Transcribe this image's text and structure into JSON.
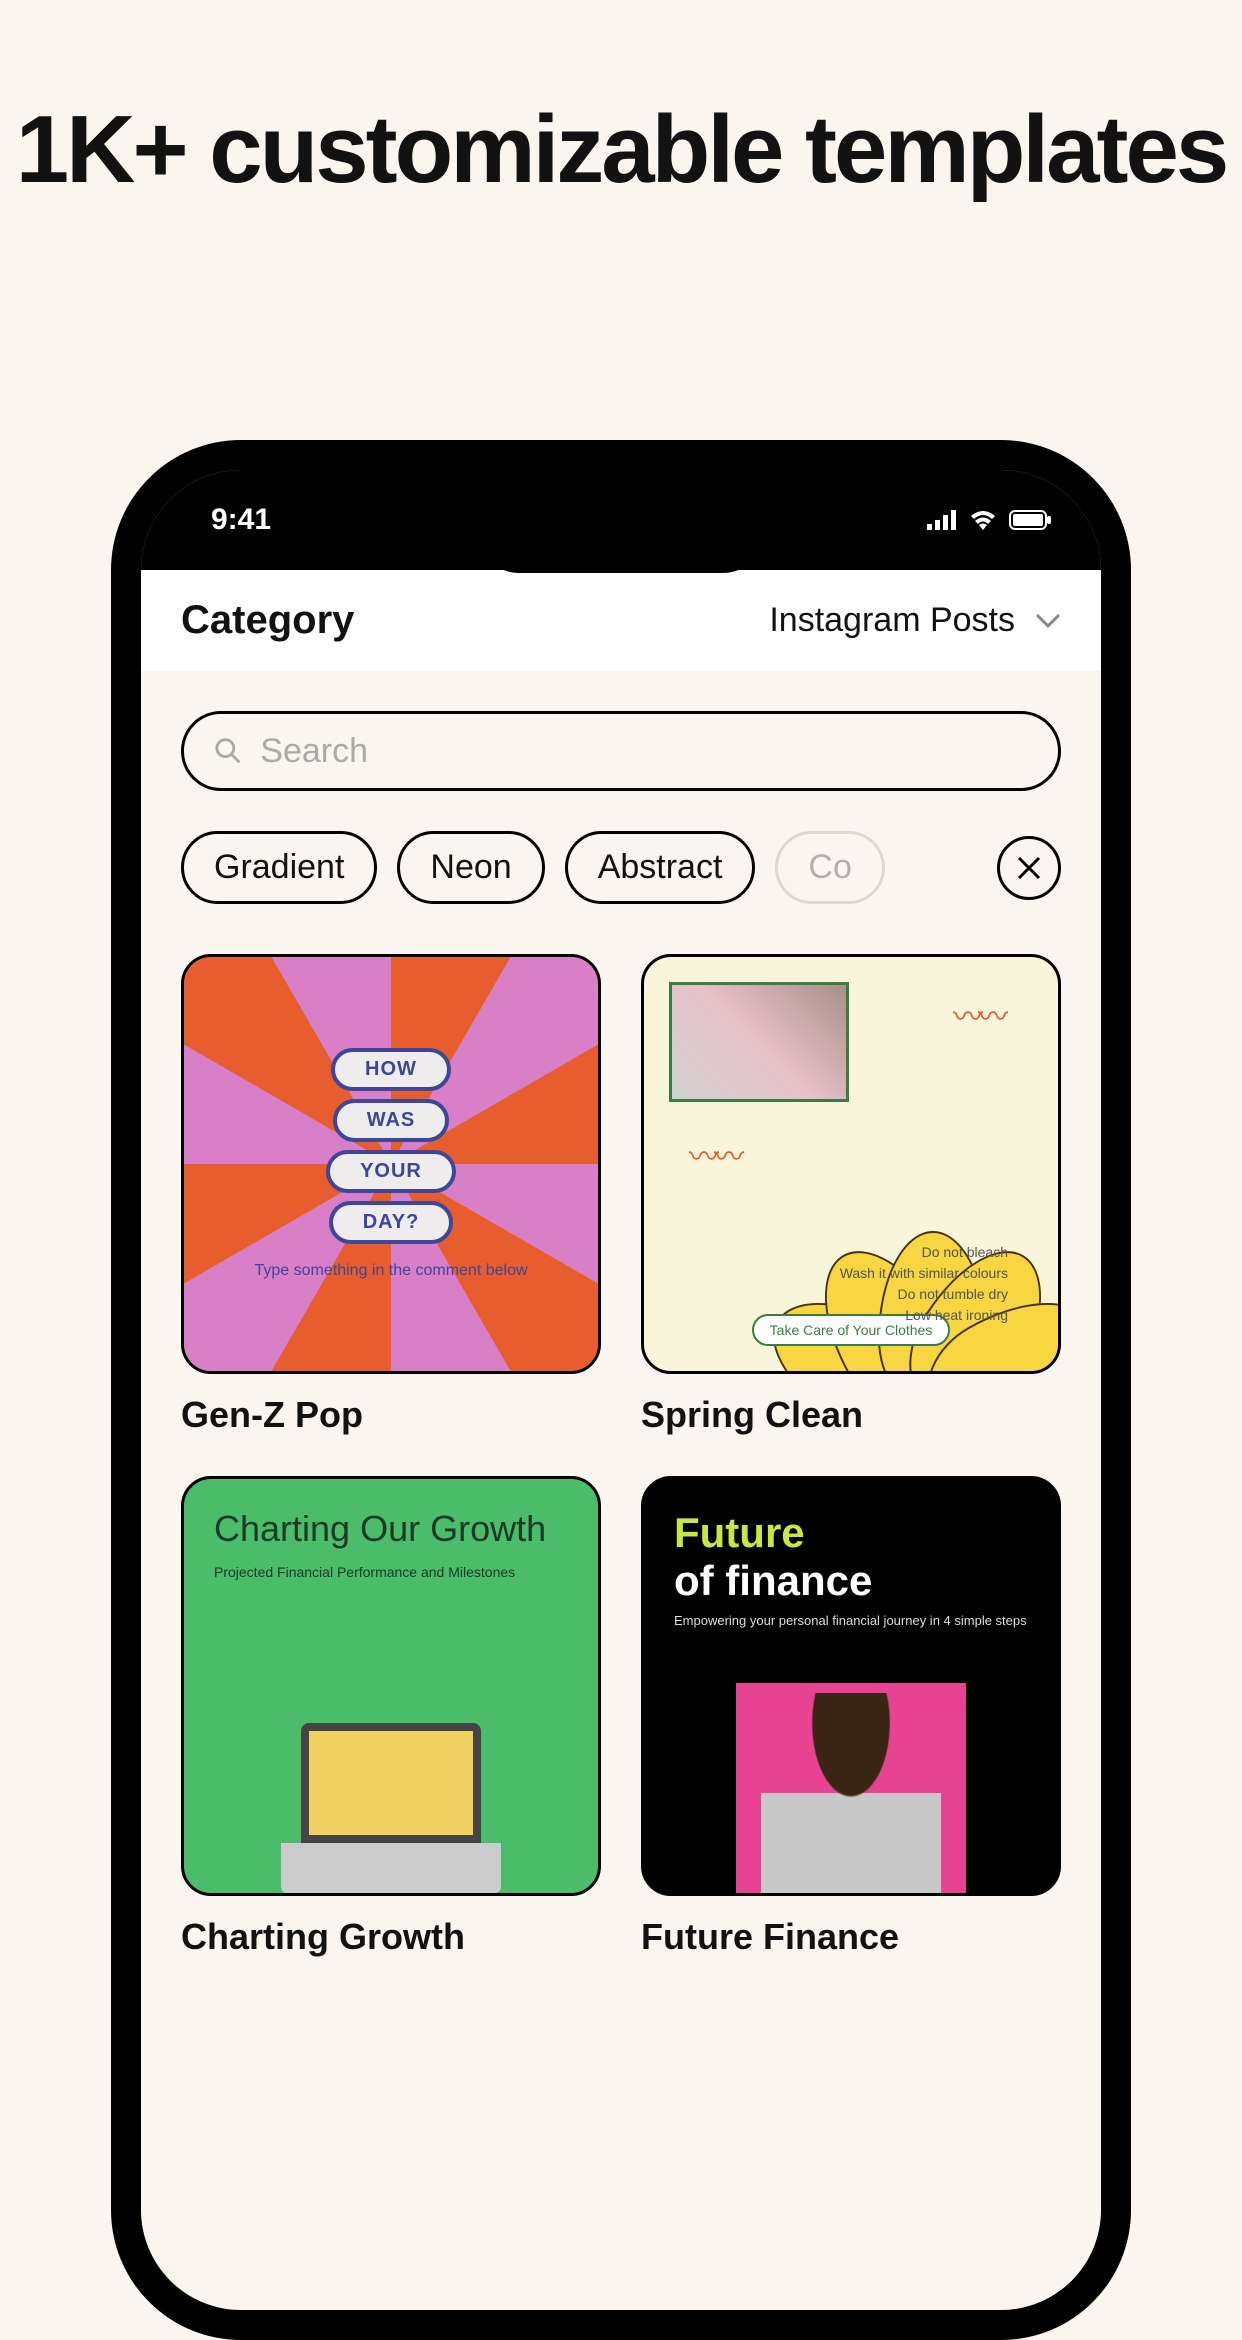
{
  "headline": "1K+ customizable templates",
  "status": {
    "time": "9:41"
  },
  "header": {
    "title": "Category",
    "selected": "Instagram Posts"
  },
  "search": {
    "placeholder": "Search"
  },
  "filters": [
    {
      "label": "Gradient"
    },
    {
      "label": "Neon"
    },
    {
      "label": "Abstract"
    },
    {
      "label": "Co"
    }
  ],
  "templates": [
    {
      "title": "Gen-Z Pop",
      "lines": [
        "HOW",
        "WAS",
        "YOUR",
        "DAY?"
      ],
      "caption": "Type something in the comment below"
    },
    {
      "title": "Spring Clean",
      "tag": "Take Care of Your Clothes",
      "list": [
        "Do not bleach",
        "Wash it with similar colours",
        "Do not tumble dry",
        "Low heat ironing"
      ]
    },
    {
      "title": "Charting Growth",
      "heading": "Charting Our Growth",
      "sub": "Projected Financial Performance and Milestones"
    },
    {
      "title": "Future Finance",
      "heading1": "Future",
      "heading2": "of finance",
      "sub": "Empowering your personal financial journey in 4 simple steps"
    }
  ]
}
